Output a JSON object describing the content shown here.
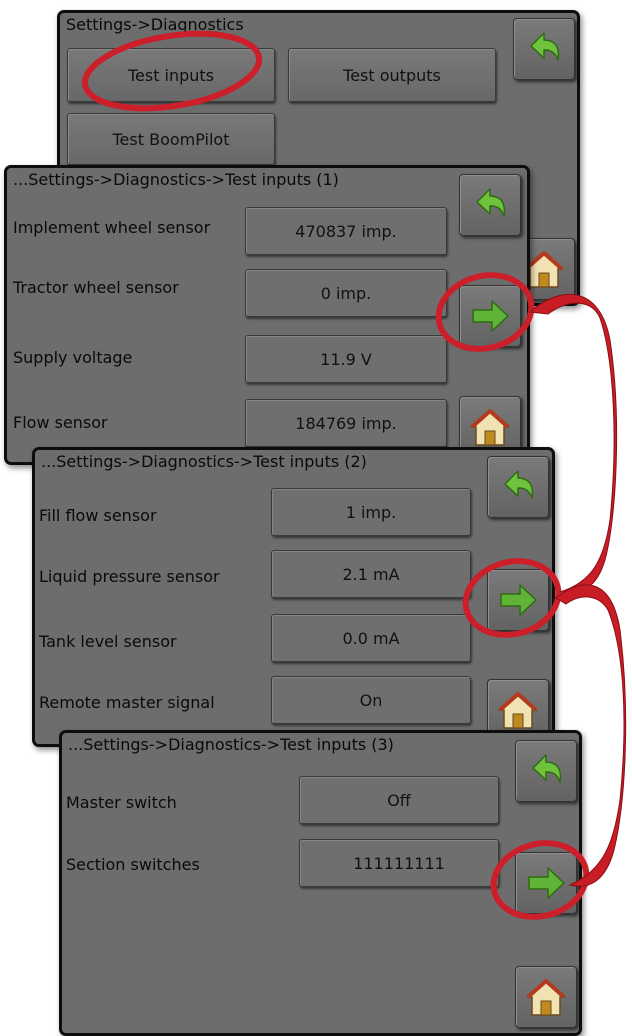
{
  "screens": [
    {
      "title": "Settings->Diagnostics",
      "buttons": {
        "test_inputs": "Test inputs",
        "test_outputs": "Test outputs",
        "test_boompilot": "Test BoomPilot"
      }
    },
    {
      "title": "...Settings->Diagnostics->Test inputs (1)",
      "rows": [
        {
          "label": "Implement wheel sensor",
          "value": "470837 imp."
        },
        {
          "label": "Tractor wheel sensor",
          "value": "0 imp."
        },
        {
          "label": "Supply voltage",
          "value": "11.9 V"
        },
        {
          "label": "Flow sensor",
          "value": "184769 imp."
        }
      ]
    },
    {
      "title": "...Settings->Diagnostics->Test inputs (2)",
      "rows": [
        {
          "label": "Fill flow sensor",
          "value": "1 imp."
        },
        {
          "label": "Liquid pressure sensor",
          "value": "2.1 mA"
        },
        {
          "label": "Tank level sensor",
          "value": "0.0 mA"
        },
        {
          "label": "Remote master signal",
          "value": "On"
        }
      ]
    },
    {
      "title": "...Settings->Diagnostics->Test inputs (3)",
      "rows": [
        {
          "label": "Master switch",
          "value": "Off"
        },
        {
          "label": "Section switches",
          "value": "111111111"
        }
      ]
    }
  ],
  "icons": {
    "back": "back-arrow-icon",
    "next": "next-arrow-icon",
    "home": "home-icon"
  },
  "colors": {
    "screen_bg": "#6d6d6d",
    "arrow_green": "#5fb336",
    "highlight_red": "#cc1f2a"
  }
}
